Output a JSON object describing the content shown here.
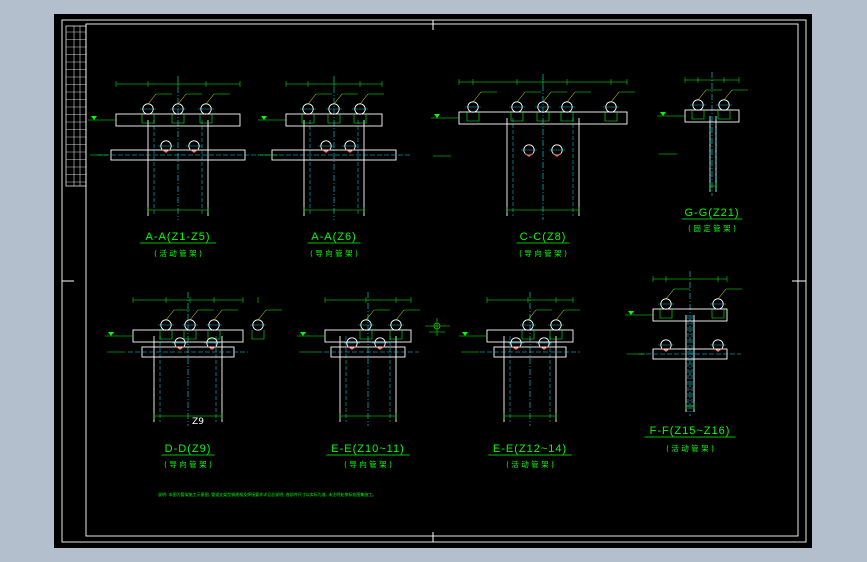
{
  "colors": {
    "viewport_background": "#b3bfcc",
    "sheet_background": "#000000",
    "frame": "#ffffff",
    "annotation": "#00ff00",
    "centerline": "#00e5ff",
    "geometry": "#ffffff",
    "hatch": "#ff3030",
    "leader": "#ffff00"
  },
  "views": [
    {
      "title": "A-A(Z1-Z5)",
      "subtitle": "( 活 动 管 架 )"
    },
    {
      "title": "A-A(Z6)",
      "subtitle": "( 导 向 管 架 )"
    },
    {
      "title": "C-C(Z8)",
      "subtitle": "( 导 向 管 架 )"
    },
    {
      "title": "G-G(Z21)",
      "subtitle": "( 固 定 管 架 )"
    },
    {
      "title": "D-D(Z9)",
      "subtitle": "( 导 向 管 架 )",
      "tag": "Z9"
    },
    {
      "title": "E-E(Z10~11)",
      "subtitle": "( 导 向 管 架 )"
    },
    {
      "title": "E-E(Z12~14)",
      "subtitle": "( 活 动 管 架 )"
    },
    {
      "title": "F-F(Z15~Z16)",
      "subtitle": "( 活 动 管 架 )"
    }
  ],
  "note_text": "说明: 本图为管架施工示意图, 管道支架型钢规格及焊接要求详见总说明, 各部件尺寸以实际为准, 未注明处按标准图集施工。"
}
